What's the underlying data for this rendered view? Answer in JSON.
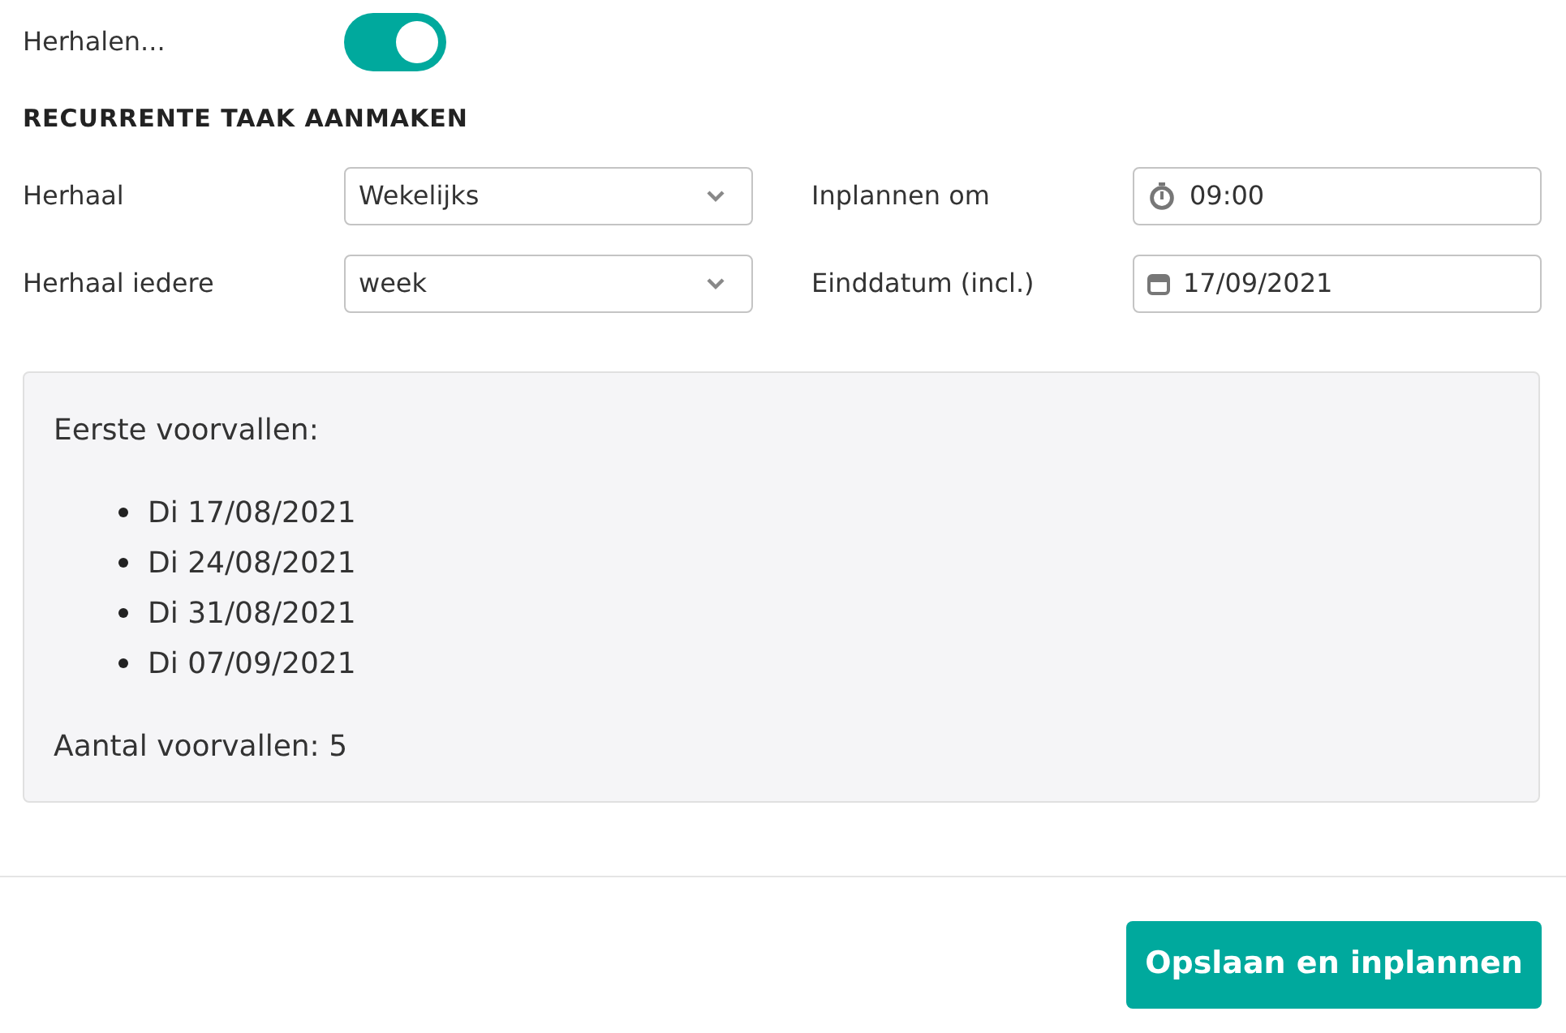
{
  "repeat_toggle": {
    "label": "Herhalen...",
    "on": true
  },
  "section_title": "RECURRENTE TAAK AANMAKEN",
  "fields": [
    {
      "label": "Herhaal",
      "kind": "select",
      "value": "Wekelijks"
    },
    {
      "label": "Inplannen om",
      "kind": "time",
      "value": "09:00"
    },
    {
      "label": "Herhaal iedere",
      "kind": "select",
      "value": "week"
    },
    {
      "label": "Einddatum (incl.)",
      "kind": "date",
      "value": "17/09/2021"
    }
  ],
  "preview": {
    "title": "Eerste voorvallen:",
    "occurrences": [
      "Di 17/08/2021",
      "Di 24/08/2021",
      "Di 31/08/2021",
      "Di 07/09/2021"
    ],
    "count": "Aantal voorvallen: 5"
  },
  "submit_button": "Opslaan en inplannen"
}
